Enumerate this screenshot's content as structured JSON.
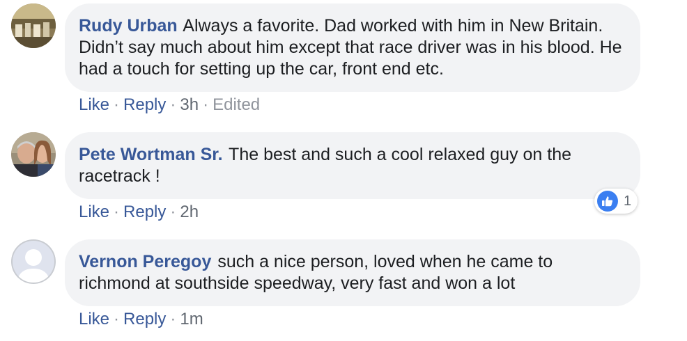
{
  "comments": [
    {
      "author": "Rudy Urban",
      "text": "Always a favorite. Dad worked with him in New Britain. Didn’t say much about him except that race driver was in his blood. He had a touch for setting up the car, front end etc.",
      "like_label": "Like",
      "reply_label": "Reply",
      "time": "3h",
      "edited_label": "Edited",
      "avatar_icon": "profile-photo-icon"
    },
    {
      "author": "Pete Wortman Sr.",
      "text": "The best and such a cool relaxed guy on the racetrack !",
      "like_label": "Like",
      "reply_label": "Reply",
      "time": "2h",
      "reaction_icon": "thumbs-up-icon",
      "reaction_count": "1",
      "avatar_icon": "profile-photo-icon"
    },
    {
      "author": "Vernon Peregoy",
      "text": "such a nice person, loved when he came to richmond at southside speedway, very fast and won a lot",
      "like_label": "Like",
      "reply_label": "Reply",
      "time": "1m",
      "avatar_icon": "default-avatar-icon"
    }
  ],
  "separator": "·",
  "colors": {
    "author": "#385898",
    "bubble": "#f2f3f5",
    "text": "#1c1e21",
    "meta": "#606770",
    "like_reaction": "#3b7ff1"
  }
}
